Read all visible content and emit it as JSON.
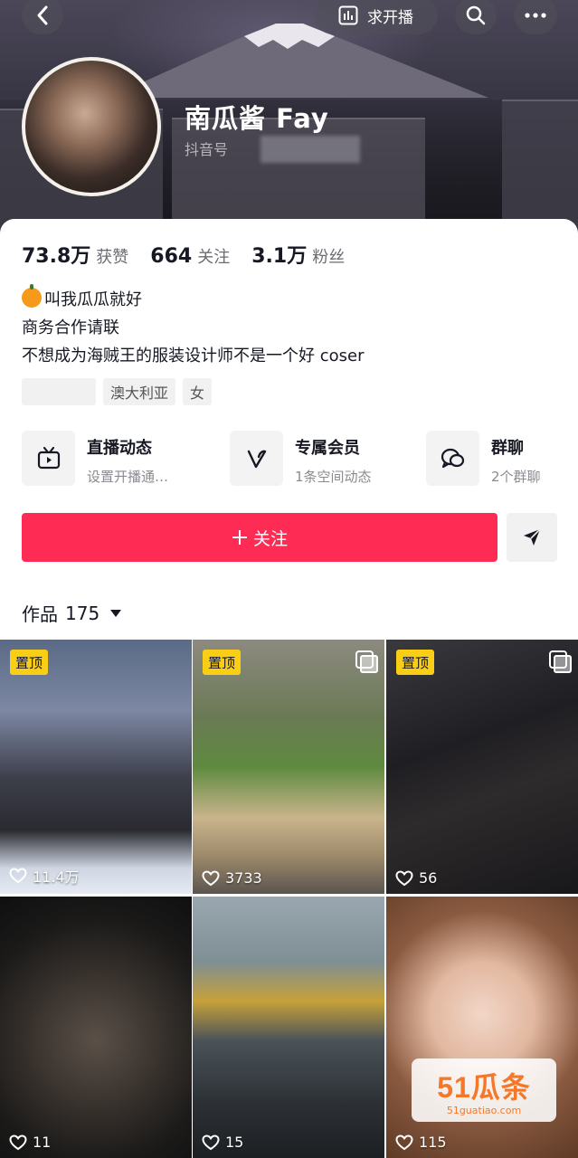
{
  "header": {
    "live_button_label": "求开播",
    "nickname": "南瓜酱 Fay",
    "douyin_id_label": "抖音号"
  },
  "stats": [
    {
      "value": "73.8万",
      "label": "获赞"
    },
    {
      "value": "664",
      "label": "关注"
    },
    {
      "value": "3.1万",
      "label": "粉丝"
    }
  ],
  "bio": {
    "line1": "叫我瓜瓜就好",
    "line2": "商务合作请联",
    "line3": "不想成为海贼王的服装设计师不是一个好 coser"
  },
  "tags": [
    "澳大利亚",
    "女"
  ],
  "features": [
    {
      "title": "直播动态",
      "subtitle": "设置开播通…",
      "icon": "tv-icon"
    },
    {
      "title": "专属会员",
      "subtitle": "1条空间动态",
      "icon": "v-icon"
    },
    {
      "title": "群聊",
      "subtitle": "2个群聊",
      "icon": "chat-bubbles-icon"
    }
  ],
  "follow_button_label": "关注",
  "works": {
    "label": "作品",
    "count": "175"
  },
  "tiles": [
    {
      "pinned": "置顶",
      "likes": "11.4万",
      "multi": false
    },
    {
      "pinned": "置顶",
      "likes": "3733",
      "multi": true
    },
    {
      "pinned": "置顶",
      "likes": "56",
      "multi": true
    },
    {
      "pinned": "",
      "likes": "11",
      "multi": false
    },
    {
      "pinned": "",
      "likes": "15",
      "multi": false
    },
    {
      "pinned": "",
      "likes": "115",
      "multi": false
    }
  ],
  "watermark": {
    "logo": "51瓜条",
    "url": "51guatiao.com"
  }
}
